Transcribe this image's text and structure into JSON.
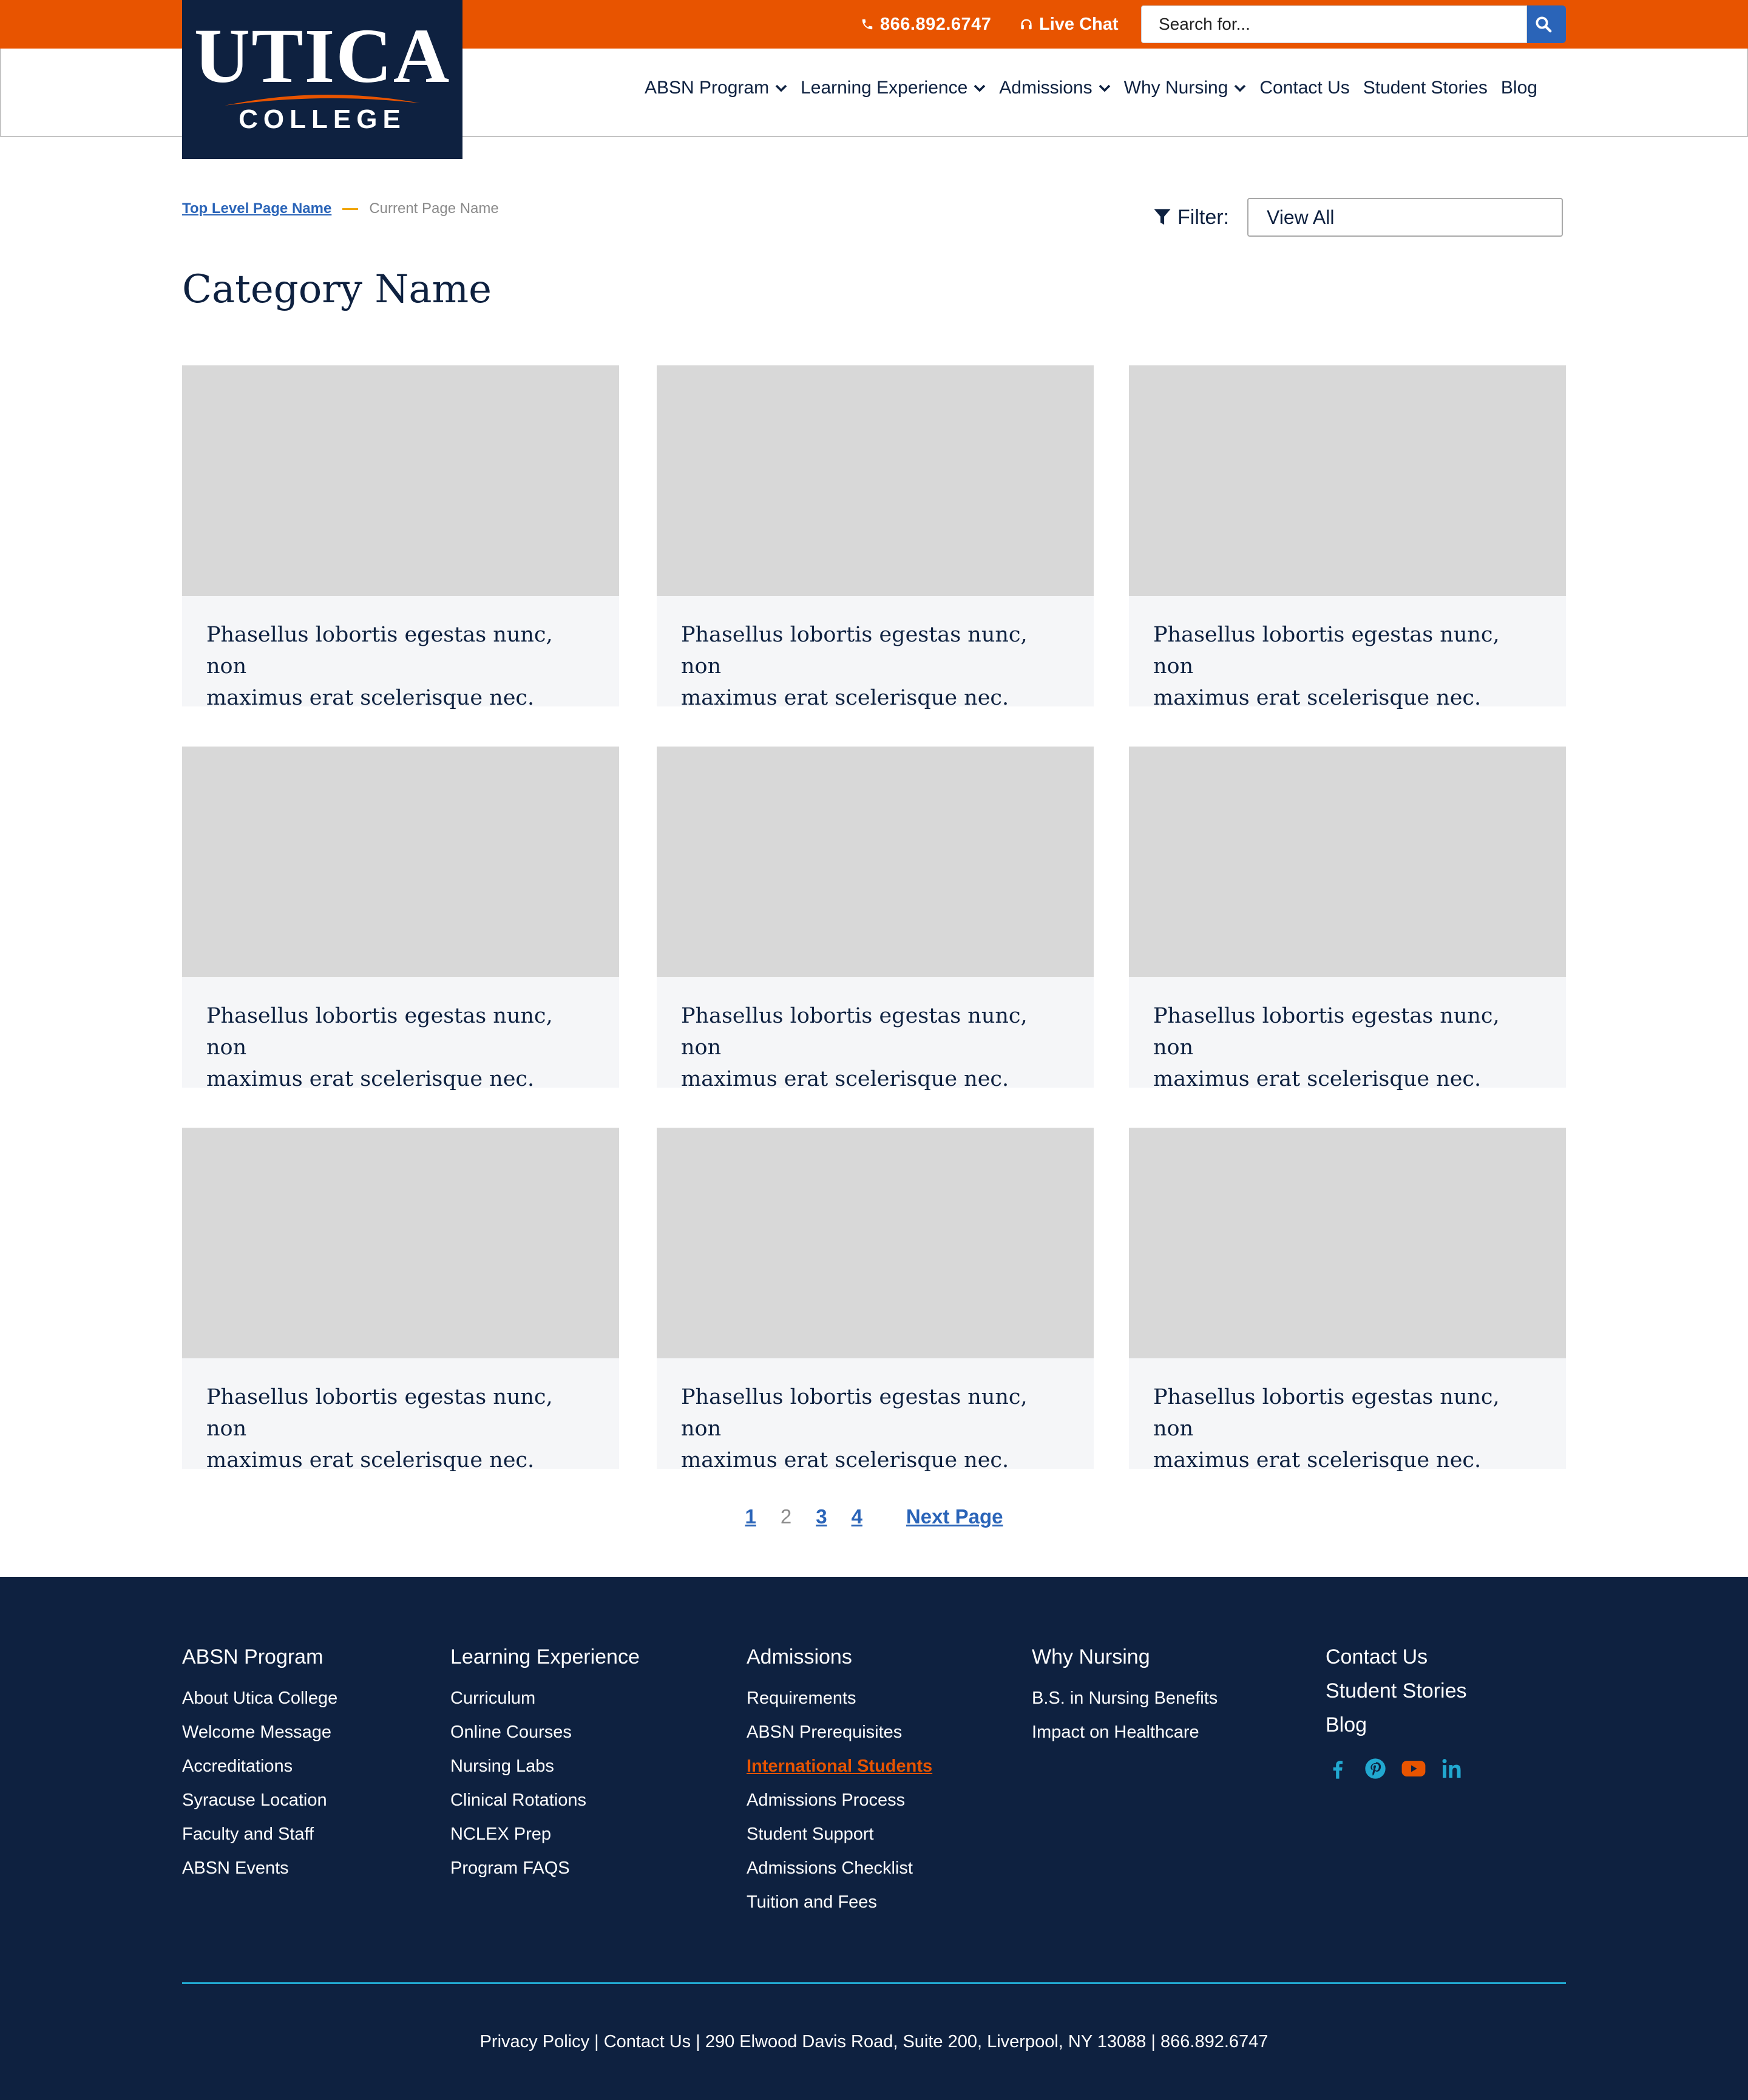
{
  "topbar": {
    "phone": "866.892.6747",
    "chat": "Live Chat",
    "search_placeholder": "Search for..."
  },
  "logo": {
    "word": "UTICA",
    "sub": "COLLEGE"
  },
  "nav": [
    {
      "label": "ABSN Program",
      "dropdown": true
    },
    {
      "label": "Learning Experience",
      "dropdown": true
    },
    {
      "label": "Admissions",
      "dropdown": true
    },
    {
      "label": "Why Nursing",
      "dropdown": true
    },
    {
      "label": "Contact Us",
      "dropdown": false
    },
    {
      "label": "Student Stories",
      "dropdown": false
    },
    {
      "label": "Blog",
      "dropdown": false
    }
  ],
  "breadcrumb": {
    "top": "Top Level Page Name",
    "current": "Current Page Name"
  },
  "filter": {
    "label": "Filter:",
    "value": "View All"
  },
  "page_title": "Category Name",
  "cards": [
    {
      "line1": "Phasellus lobortis egestas nunc, non",
      "line2": "maximus erat scelerisque nec."
    },
    {
      "line1": "Phasellus lobortis egestas nunc, non",
      "line2": "maximus erat scelerisque nec."
    },
    {
      "line1": "Phasellus lobortis egestas nunc, non",
      "line2": "maximus erat scelerisque nec."
    },
    {
      "line1": "Phasellus lobortis egestas nunc, non",
      "line2": "maximus erat scelerisque nec."
    },
    {
      "line1": "Phasellus lobortis egestas nunc, non",
      "line2": "maximus erat scelerisque nec."
    },
    {
      "line1": "Phasellus lobortis egestas nunc, non",
      "line2": "maximus erat scelerisque nec."
    },
    {
      "line1": "Phasellus lobortis egestas nunc, non",
      "line2": "maximus erat scelerisque nec."
    },
    {
      "line1": "Phasellus lobortis egestas nunc, non",
      "line2": "maximus erat scelerisque nec."
    },
    {
      "line1": "Phasellus lobortis egestas nunc, non",
      "line2": "maximus erat scelerisque nec."
    }
  ],
  "pagination": {
    "pages": [
      "1",
      "2",
      "3",
      "4"
    ],
    "current": "2",
    "next": "Next Page"
  },
  "footer": {
    "col1": {
      "head": "ABSN Program",
      "links": [
        "About Utica College",
        "Welcome Message",
        "Accreditations",
        "Syracuse Location",
        "Faculty and Staff",
        "ABSN Events"
      ]
    },
    "col2": {
      "head": "Learning Experience",
      "links": [
        "Curriculum",
        "Online Courses",
        "Nursing Labs",
        "Clinical Rotations",
        "NCLEX Prep",
        "Program FAQS"
      ]
    },
    "col3": {
      "head": "Admissions",
      "links": [
        "Requirements",
        "ABSN Prerequisites",
        "International Students",
        "Admissions Process",
        "Student Support",
        "Admissions Checklist",
        "Tuition and Fees"
      ],
      "active": "International Students"
    },
    "col4": {
      "head": "Why Nursing",
      "links": [
        "B.S. in Nursing Benefits",
        "Impact on Healthcare"
      ]
    },
    "col5": {
      "links": [
        "Contact Us",
        "Student Stories",
        "Blog"
      ]
    },
    "social": [
      "facebook-icon",
      "pinterest-icon",
      "youtube-icon",
      "linkedin-icon"
    ],
    "legal": "Privacy Policy | Contact Us | 290 Elwood Davis Road, Suite 200, Liverpool, NY 13088 | 866.892.6747"
  },
  "colors": {
    "orange": "#e85400",
    "navy": "#0e2140",
    "blue": "#2a64b8",
    "teal": "#21a8d0",
    "gold": "#f0a500"
  }
}
